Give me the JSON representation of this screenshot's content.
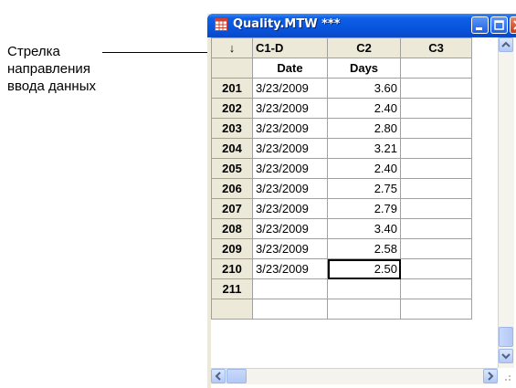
{
  "annotation": {
    "line1": "Стрелка",
    "line2": "направления",
    "line3": "ввода данных"
  },
  "window": {
    "title": "Quality.MTW ***",
    "icon": "worksheet-icon"
  },
  "grid": {
    "corner_arrow": "↓",
    "columns": [
      "C1-D",
      "C2",
      "C3"
    ],
    "names": [
      "Date",
      "Days",
      ""
    ],
    "rows": [
      {
        "row": "201",
        "date": "3/23/2009",
        "days": "3.60"
      },
      {
        "row": "202",
        "date": "3/23/2009",
        "days": "2.40"
      },
      {
        "row": "203",
        "date": "3/23/2009",
        "days": "2.80"
      },
      {
        "row": "204",
        "date": "3/23/2009",
        "days": "3.21"
      },
      {
        "row": "205",
        "date": "3/23/2009",
        "days": "2.40"
      },
      {
        "row": "206",
        "date": "3/23/2009",
        "days": "2.75"
      },
      {
        "row": "207",
        "date": "3/23/2009",
        "days": "2.79"
      },
      {
        "row": "208",
        "date": "3/23/2009",
        "days": "3.40"
      },
      {
        "row": "209",
        "date": "3/23/2009",
        "days": "2.58"
      },
      {
        "row": "210",
        "date": "3/23/2009",
        "days": "2.50"
      },
      {
        "row": "211",
        "date": "",
        "days": ""
      }
    ]
  }
}
